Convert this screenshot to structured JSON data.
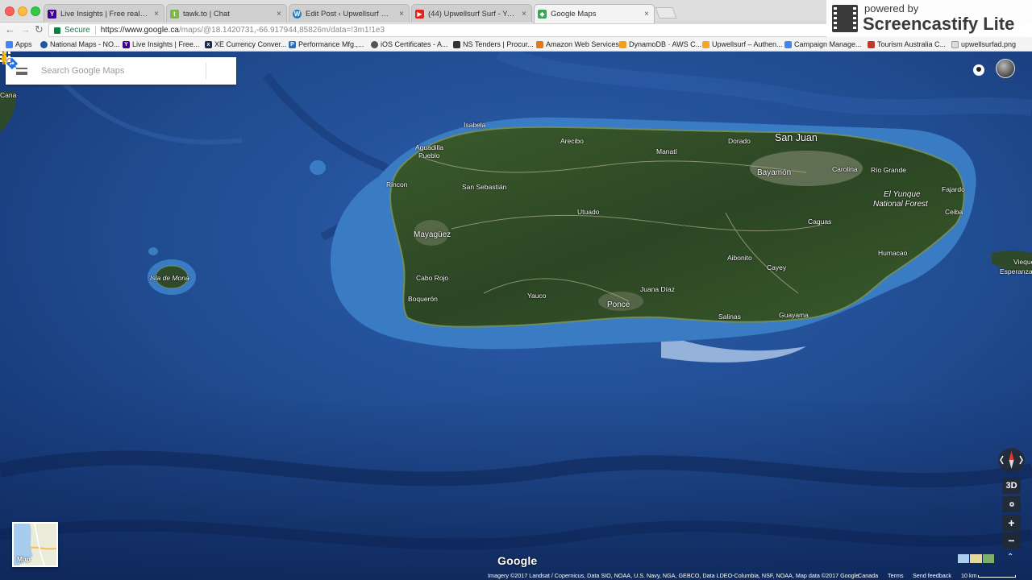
{
  "browser": {
    "tabs": [
      {
        "title": "Live Insights | Free real time v",
        "icon": "yahoo-icon",
        "active": false
      },
      {
        "title": "tawk.to | Chat",
        "icon": "tawk-icon",
        "active": false
      },
      {
        "title": "Edit Post ‹ Upwellsurf — Word",
        "icon": "wordpress-icon",
        "active": false
      },
      {
        "title": "(44) Upwellsurf Surf - YouTube",
        "icon": "youtube-icon",
        "active": false
      },
      {
        "title": "Google Maps",
        "icon": "google-maps-icon",
        "active": true
      }
    ],
    "secure_label": "Secure",
    "url_host": "https://www.google.ca",
    "url_path": "/maps/@18.1420731,-66.917944,85826m/data=!3m1!1e3",
    "bookmarks": [
      "Apps",
      "National Maps - NO...",
      "Live Insights | Free...",
      "XE Currency Conver...",
      "Performance Mfg.,...",
      "iOS Certificates - A...",
      "NS Tenders | Procur...",
      "Amazon Web Services",
      "DynamoDB · AWS C...",
      "Upwellsurf – Authen...",
      "Campaign Manage...",
      "Tourism Australia C...",
      "upwellsurfad.png"
    ]
  },
  "search": {
    "placeholder": "Search Google Maps"
  },
  "map": {
    "places": [
      {
        "name": "Cana",
        "size": "small"
      },
      {
        "name": "Isabela",
        "size": "small"
      },
      {
        "name": "Aguadilla",
        "size": "small"
      },
      {
        "name": "Pueblo",
        "size": "small"
      },
      {
        "name": "Rincon",
        "size": "small"
      },
      {
        "name": "San Sebastián",
        "size": "small"
      },
      {
        "name": "Arecibo",
        "size": "small"
      },
      {
        "name": "Manatí",
        "size": "small"
      },
      {
        "name": "Dorado",
        "size": "small"
      },
      {
        "name": "San Juan",
        "size": "big"
      },
      {
        "name": "Bayamón",
        "size": "med"
      },
      {
        "name": "Carolina",
        "size": "small"
      },
      {
        "name": "Río Grande",
        "size": "small"
      },
      {
        "name": "Fajardo",
        "size": "small"
      },
      {
        "name": "El Yunque",
        "size": "med"
      },
      {
        "name": "National Forest",
        "size": "med"
      },
      {
        "name": "Ceiba",
        "size": "small"
      },
      {
        "name": "Utuado",
        "size": "small"
      },
      {
        "name": "Mayagüez",
        "size": "med"
      },
      {
        "name": "Caguas",
        "size": "small"
      },
      {
        "name": "Isla de Mona",
        "size": "small"
      },
      {
        "name": "Aibonito",
        "size": "small"
      },
      {
        "name": "Humacao",
        "size": "small"
      },
      {
        "name": "Vieque",
        "size": "small"
      },
      {
        "name": "Esperanza",
        "size": "small"
      },
      {
        "name": "Cabo Rojo",
        "size": "small"
      },
      {
        "name": "Cayey",
        "size": "small"
      },
      {
        "name": "Boquerón",
        "size": "small"
      },
      {
        "name": "Yauco",
        "size": "small"
      },
      {
        "name": "Juana Díaz",
        "size": "small"
      },
      {
        "name": "Ponce",
        "size": "med"
      },
      {
        "name": "Salinas",
        "size": "small"
      },
      {
        "name": "Guayama",
        "size": "small"
      }
    ],
    "minimap_label": "Map",
    "view_3d": "3D",
    "zoom_in": "+",
    "zoom_out": "−",
    "logo": "Google",
    "attribution": "Imagery ©2017 Landsat / Copernicus, Data SIO, NOAA, U.S. Navy, NGA, GEBCO, Data LDEO-Columbia, NSF, NOAA, Map data ©2017 Google",
    "region": "Canada",
    "terms": "Terms",
    "feedback": "Send feedback",
    "scale": "10 km"
  },
  "overlay": {
    "powered": "powered by",
    "brand": "Screencastify Lite"
  },
  "colors": {
    "ocean_deep": "#16336a",
    "ocean_mid": "#2a5aa8",
    "shelf": "#3d7fc9",
    "land": "#2f4a26",
    "secure_green": "#0b8043"
  }
}
